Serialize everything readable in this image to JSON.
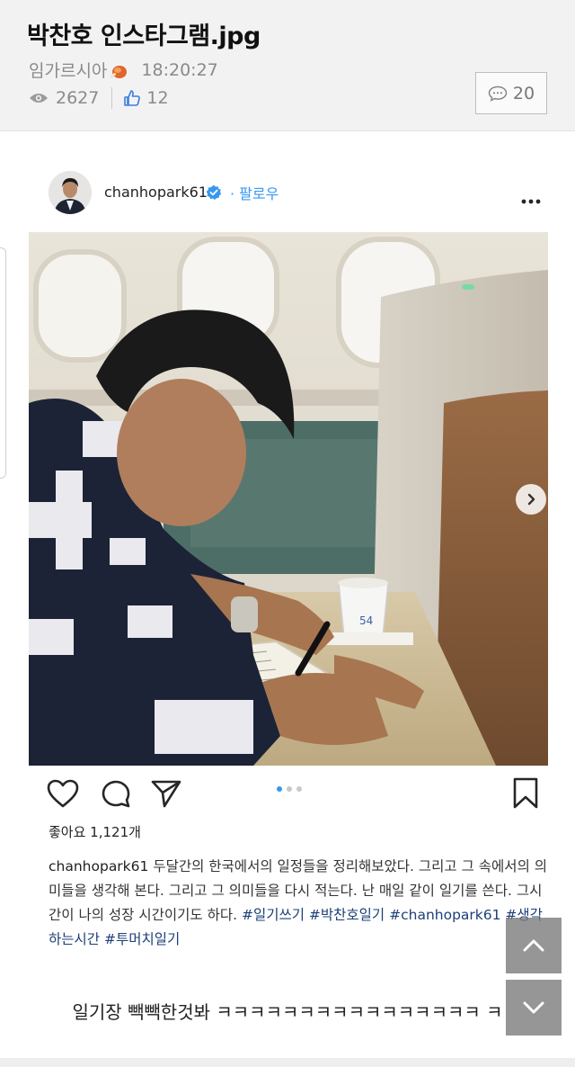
{
  "post": {
    "title": "박찬호 인스타그램.jpg",
    "author": "임가르시아",
    "time": "18:20:27",
    "views": "2627",
    "likes": "12",
    "comments": "20"
  },
  "instagram": {
    "username": "chanhopark61",
    "follow": "· 팔로우",
    "likes_text": "좋아요 1,121개",
    "caption_user": "chanhopark61",
    "caption_body": " 두달간의 한국에서의 일정들을 정리해보았다. 그리고 그 속에서의 의미들을 생각해 본다. 그리고 그 의미들을 다시 적는다. 난 매일 같이 일기를 쓴다. 그시간이 나의 성장 시간이기도 하다. ",
    "hashtags": "#일기쓰기 #박찬호일기 #chanhopark61 #생각하는시간 #투머치일기",
    "carousel_dots": 3,
    "carousel_active": 0
  },
  "comment": {
    "text": "일기장 빽빽한것봐 ㅋㅋㅋㅋㅋㅋㅋㅋㅋㅋㅋㅋㅋㅋㅋㅋ ㅋ"
  },
  "colors": {
    "accent": "#3897f0",
    "hashtag": "#1d3f77",
    "meta": "#8a8a8a"
  }
}
